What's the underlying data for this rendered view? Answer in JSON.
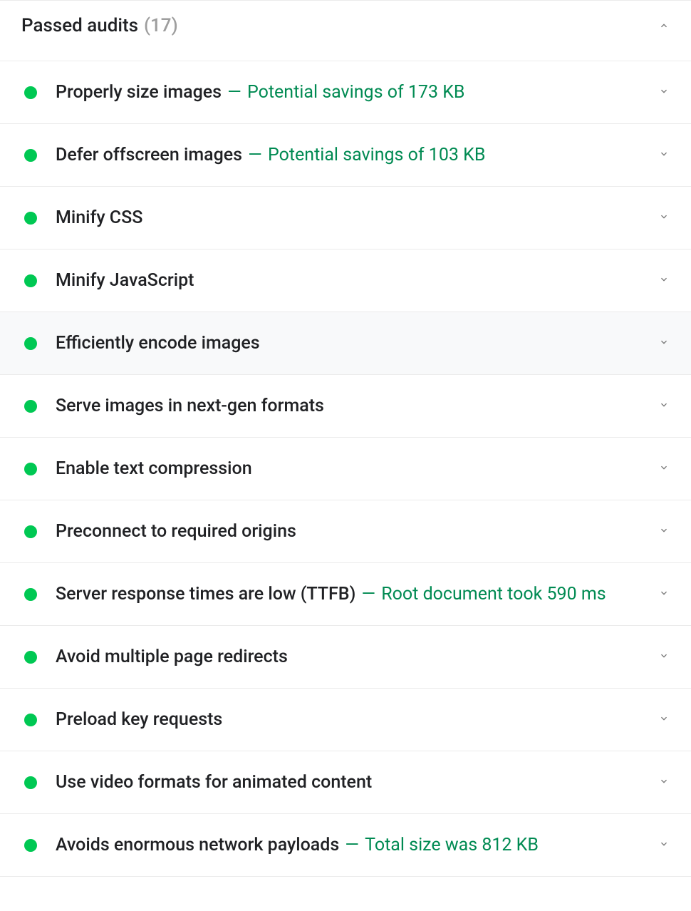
{
  "header": {
    "title": "Passed audits",
    "count": "(17)"
  },
  "colors": {
    "pass": "#00c853",
    "detail_text": "#008a52"
  },
  "audits": [
    {
      "title": "Properly size images",
      "detail": "Potential savings of 173 KB"
    },
    {
      "title": "Defer offscreen images",
      "detail": "Potential savings of 103 KB"
    },
    {
      "title": "Minify CSS",
      "detail": ""
    },
    {
      "title": "Minify JavaScript",
      "detail": ""
    },
    {
      "title": "Efficiently encode images",
      "detail": "",
      "hovered": true
    },
    {
      "title": "Serve images in next-gen formats",
      "detail": ""
    },
    {
      "title": "Enable text compression",
      "detail": ""
    },
    {
      "title": "Preconnect to required origins",
      "detail": ""
    },
    {
      "title": "Server response times are low (TTFB)",
      "detail": "Root document took 590 ms",
      "multiline": true
    },
    {
      "title": "Avoid multiple page redirects",
      "detail": ""
    },
    {
      "title": "Preload key requests",
      "detail": ""
    },
    {
      "title": "Use video formats for animated content",
      "detail": ""
    },
    {
      "title": "Avoids enormous network payloads",
      "detail": "Total size was 812 KB",
      "multiline": true
    }
  ]
}
